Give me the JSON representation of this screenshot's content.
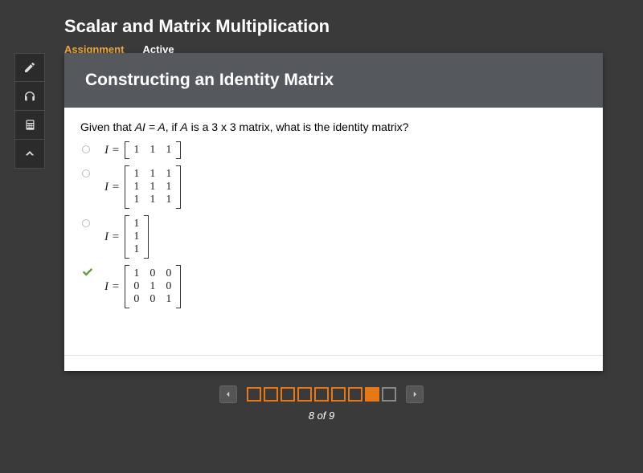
{
  "header": {
    "title": "Scalar and Matrix Multiplication",
    "assignment_label": "Assignment",
    "status_label": "Active"
  },
  "toolbar": {
    "items": [
      "pencil-icon",
      "headphones-icon",
      "calculator-icon",
      "collapse-icon"
    ]
  },
  "question": {
    "title": "Constructing an Identity Matrix",
    "prompt_prefix": "Given that ",
    "prompt_equation": "AI = A",
    "prompt_middle": ", if ",
    "prompt_var": "A",
    "prompt_suffix": " is a 3 x 3 matrix, what is the identity matrix?",
    "eq_label": "I =",
    "options": [
      {
        "state": "unselected",
        "rows": 1,
        "cols": 3,
        "cells": [
          "1",
          "1",
          "1"
        ]
      },
      {
        "state": "unselected",
        "rows": 3,
        "cols": 3,
        "cells": [
          "1",
          "1",
          "1",
          "1",
          "1",
          "1",
          "1",
          "1",
          "1"
        ]
      },
      {
        "state": "unselected",
        "rows": 3,
        "cols": 1,
        "cells": [
          "1",
          "1",
          "1"
        ]
      },
      {
        "state": "correct",
        "rows": 3,
        "cols": 3,
        "cells": [
          "1",
          "0",
          "0",
          "0",
          "1",
          "0",
          "0",
          "0",
          "1"
        ]
      }
    ]
  },
  "pager": {
    "current": 8,
    "total": 9,
    "display": "8 of 9"
  }
}
